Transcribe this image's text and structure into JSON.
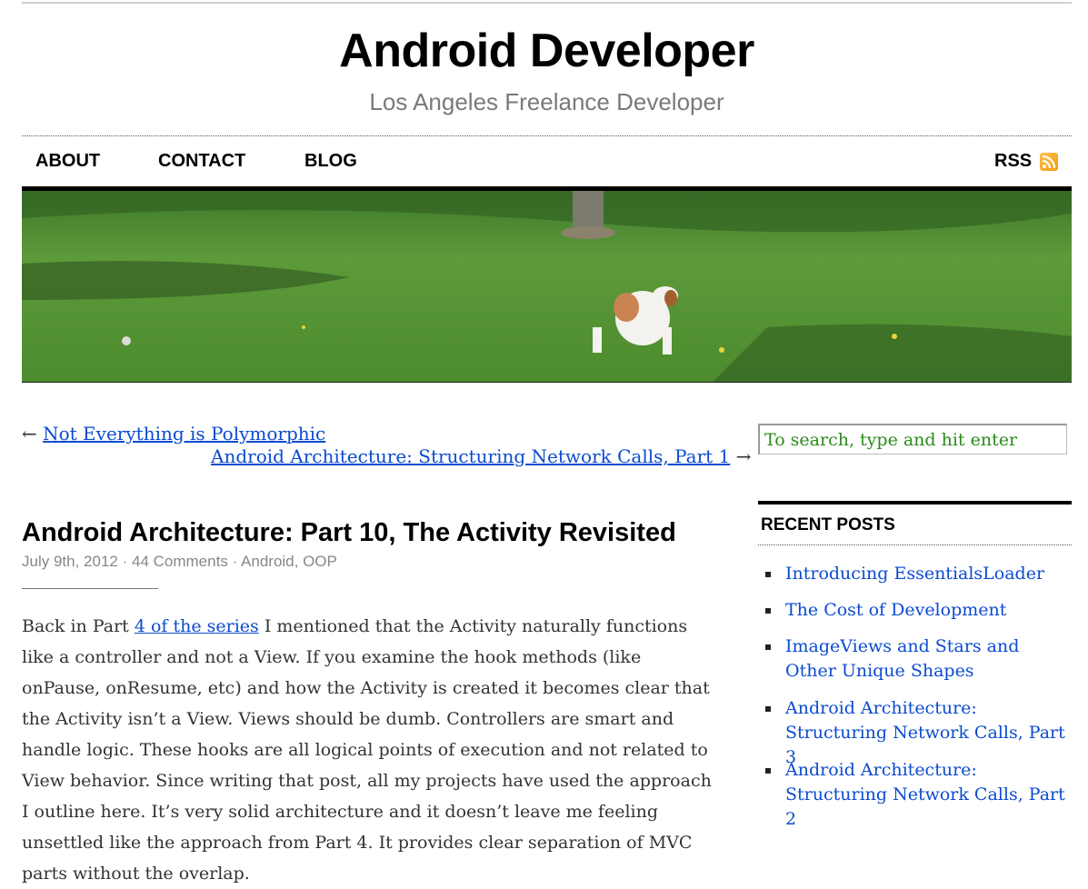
{
  "site": {
    "title": "Android Developer",
    "tagline": "Los Angeles Freelance Developer"
  },
  "nav": {
    "items": [
      {
        "label": "ABOUT"
      },
      {
        "label": "CONTACT"
      },
      {
        "label": "BLOG"
      }
    ],
    "rss_label": "RSS",
    "rss_icon": "rss-icon"
  },
  "banner": {
    "icon": "header-photo-dog-in-grass"
  },
  "post_nav": {
    "prev_arrow": "←",
    "prev_label": "Not Everything is Polymorphic",
    "next_label": "Android Architecture: Structuring Network Calls, Part 1",
    "next_arrow": "→"
  },
  "post": {
    "title": "Android Architecture: Part 10, The Activity Revisited",
    "date": "July 9th, 2012",
    "separator": "·",
    "comments": "44 Comments",
    "categories": "Android, OOP",
    "body_part1": "Back in Part ",
    "body_link": "4 of the series",
    "body_part2": " I mentioned that the Activity naturally functions like a controller and not a View. If you examine the hook methods (like onPause, onResume, etc) and how the Activity is created it becomes clear that the Activity isn’t a View. Views should be dumb. Controllers are smart and handle logic. These hooks are all logical points of execution and not related to View behavior. Since writing that post, all my projects have used the approach I outline here. It’s very solid architecture and it doesn’t leave me feeling unsettled like the approach from Part 4. It provides clear separation of MVC parts without the overlap."
  },
  "sidebar": {
    "search_placeholder": "To search, type and hit enter",
    "recent_title": "RECENT POSTS",
    "recent_posts": [
      {
        "label": "Introducing EssentialsLoader"
      },
      {
        "label": "The Cost of Development"
      },
      {
        "label": "ImageViews and Stars and Other Unique Shapes"
      },
      {
        "label": "Android Architecture: Structuring Network Calls, Part 3"
      },
      {
        "label": "Android Architecture: Structuring Network Calls, Part 2"
      }
    ]
  },
  "colors": {
    "link": "#0b4bd1",
    "search_text": "#2a8a1a",
    "rss_orange": "#f39a13"
  }
}
